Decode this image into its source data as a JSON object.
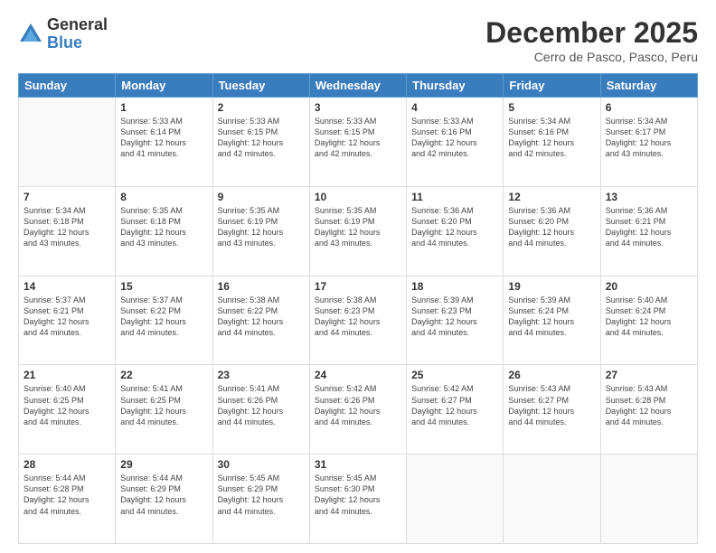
{
  "header": {
    "logo_general": "General",
    "logo_blue": "Blue",
    "title": "December 2025",
    "subtitle": "Cerro de Pasco, Pasco, Peru"
  },
  "days_of_week": [
    "Sunday",
    "Monday",
    "Tuesday",
    "Wednesday",
    "Thursday",
    "Friday",
    "Saturday"
  ],
  "weeks": [
    [
      {
        "day": "",
        "content": ""
      },
      {
        "day": "1",
        "content": "Sunrise: 5:33 AM\nSunset: 6:14 PM\nDaylight: 12 hours\nand 41 minutes."
      },
      {
        "day": "2",
        "content": "Sunrise: 5:33 AM\nSunset: 6:15 PM\nDaylight: 12 hours\nand 42 minutes."
      },
      {
        "day": "3",
        "content": "Sunrise: 5:33 AM\nSunset: 6:15 PM\nDaylight: 12 hours\nand 42 minutes."
      },
      {
        "day": "4",
        "content": "Sunrise: 5:33 AM\nSunset: 6:16 PM\nDaylight: 12 hours\nand 42 minutes."
      },
      {
        "day": "5",
        "content": "Sunrise: 5:34 AM\nSunset: 6:16 PM\nDaylight: 12 hours\nand 42 minutes."
      },
      {
        "day": "6",
        "content": "Sunrise: 5:34 AM\nSunset: 6:17 PM\nDaylight: 12 hours\nand 43 minutes."
      }
    ],
    [
      {
        "day": "7",
        "content": "Sunrise: 5:34 AM\nSunset: 6:18 PM\nDaylight: 12 hours\nand 43 minutes."
      },
      {
        "day": "8",
        "content": "Sunrise: 5:35 AM\nSunset: 6:18 PM\nDaylight: 12 hours\nand 43 minutes."
      },
      {
        "day": "9",
        "content": "Sunrise: 5:35 AM\nSunset: 6:19 PM\nDaylight: 12 hours\nand 43 minutes."
      },
      {
        "day": "10",
        "content": "Sunrise: 5:35 AM\nSunset: 6:19 PM\nDaylight: 12 hours\nand 43 minutes."
      },
      {
        "day": "11",
        "content": "Sunrise: 5:36 AM\nSunset: 6:20 PM\nDaylight: 12 hours\nand 44 minutes."
      },
      {
        "day": "12",
        "content": "Sunrise: 5:36 AM\nSunset: 6:20 PM\nDaylight: 12 hours\nand 44 minutes."
      },
      {
        "day": "13",
        "content": "Sunrise: 5:36 AM\nSunset: 6:21 PM\nDaylight: 12 hours\nand 44 minutes."
      }
    ],
    [
      {
        "day": "14",
        "content": "Sunrise: 5:37 AM\nSunset: 6:21 PM\nDaylight: 12 hours\nand 44 minutes."
      },
      {
        "day": "15",
        "content": "Sunrise: 5:37 AM\nSunset: 6:22 PM\nDaylight: 12 hours\nand 44 minutes."
      },
      {
        "day": "16",
        "content": "Sunrise: 5:38 AM\nSunset: 6:22 PM\nDaylight: 12 hours\nand 44 minutes."
      },
      {
        "day": "17",
        "content": "Sunrise: 5:38 AM\nSunset: 6:23 PM\nDaylight: 12 hours\nand 44 minutes."
      },
      {
        "day": "18",
        "content": "Sunrise: 5:39 AM\nSunset: 6:23 PM\nDaylight: 12 hours\nand 44 minutes."
      },
      {
        "day": "19",
        "content": "Sunrise: 5:39 AM\nSunset: 6:24 PM\nDaylight: 12 hours\nand 44 minutes."
      },
      {
        "day": "20",
        "content": "Sunrise: 5:40 AM\nSunset: 6:24 PM\nDaylight: 12 hours\nand 44 minutes."
      }
    ],
    [
      {
        "day": "21",
        "content": "Sunrise: 5:40 AM\nSunset: 6:25 PM\nDaylight: 12 hours\nand 44 minutes."
      },
      {
        "day": "22",
        "content": "Sunrise: 5:41 AM\nSunset: 6:25 PM\nDaylight: 12 hours\nand 44 minutes."
      },
      {
        "day": "23",
        "content": "Sunrise: 5:41 AM\nSunset: 6:26 PM\nDaylight: 12 hours\nand 44 minutes."
      },
      {
        "day": "24",
        "content": "Sunrise: 5:42 AM\nSunset: 6:26 PM\nDaylight: 12 hours\nand 44 minutes."
      },
      {
        "day": "25",
        "content": "Sunrise: 5:42 AM\nSunset: 6:27 PM\nDaylight: 12 hours\nand 44 minutes."
      },
      {
        "day": "26",
        "content": "Sunrise: 5:43 AM\nSunset: 6:27 PM\nDaylight: 12 hours\nand 44 minutes."
      },
      {
        "day": "27",
        "content": "Sunrise: 5:43 AM\nSunset: 6:28 PM\nDaylight: 12 hours\nand 44 minutes."
      }
    ],
    [
      {
        "day": "28",
        "content": "Sunrise: 5:44 AM\nSunset: 6:28 PM\nDaylight: 12 hours\nand 44 minutes."
      },
      {
        "day": "29",
        "content": "Sunrise: 5:44 AM\nSunset: 6:29 PM\nDaylight: 12 hours\nand 44 minutes."
      },
      {
        "day": "30",
        "content": "Sunrise: 5:45 AM\nSunset: 6:29 PM\nDaylight: 12 hours\nand 44 minutes."
      },
      {
        "day": "31",
        "content": "Sunrise: 5:45 AM\nSunset: 6:30 PM\nDaylight: 12 hours\nand 44 minutes."
      },
      {
        "day": "",
        "content": ""
      },
      {
        "day": "",
        "content": ""
      },
      {
        "day": "",
        "content": ""
      }
    ]
  ]
}
